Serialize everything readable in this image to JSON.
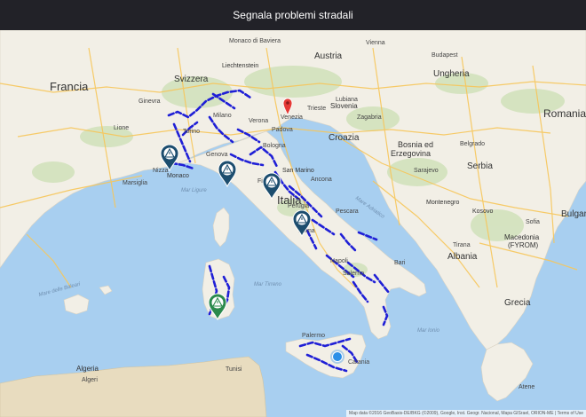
{
  "header": {
    "title": "Segnala problemi stradali"
  },
  "map": {
    "countries": [
      {
        "name": "Francia",
        "id": "francia"
      },
      {
        "name": "Svizzera",
        "id": "svizzera"
      },
      {
        "name": "Austria",
        "id": "austria"
      },
      {
        "name": "Ungheria",
        "id": "ungheria"
      },
      {
        "name": "Romania",
        "id": "romania"
      },
      {
        "name": "Slovenia",
        "id": "slovenia"
      },
      {
        "name": "Croazia",
        "id": "croazia"
      },
      {
        "name": "Bosnia ed",
        "id": "bosnia1"
      },
      {
        "name": "Erzegovina",
        "id": "bosnia2"
      },
      {
        "name": "Serbia",
        "id": "serbia"
      },
      {
        "name": "Italia",
        "id": "italia"
      },
      {
        "name": "Montenegro",
        "id": "montenegro"
      },
      {
        "name": "Kosovo",
        "id": "kosovo"
      },
      {
        "name": "Bulgaria",
        "id": "bulgaria"
      },
      {
        "name": "Macedonia",
        "id": "macedonia1"
      },
      {
        "name": "(FYROM)",
        "id": "macedonia2"
      },
      {
        "name": "Albania",
        "id": "albania"
      },
      {
        "name": "Grecia",
        "id": "grecia"
      },
      {
        "name": "Liechtenstein",
        "id": "liechtenstein"
      },
      {
        "name": "San Marino",
        "id": "sanmarino"
      },
      {
        "name": "Monaco",
        "id": "monaco"
      },
      {
        "name": "Algeria",
        "id": "algeria"
      }
    ],
    "cities": [
      {
        "name": "Torino",
        "id": "torino"
      },
      {
        "name": "Milano",
        "id": "milano"
      },
      {
        "name": "Genova",
        "id": "genova"
      },
      {
        "name": "Venezia",
        "id": "venezia"
      },
      {
        "name": "Padova",
        "id": "padova"
      },
      {
        "name": "Bologna",
        "id": "bologna"
      },
      {
        "name": "Firenze",
        "id": "firenze"
      },
      {
        "name": "Roma",
        "id": "roma"
      },
      {
        "name": "Napoli",
        "id": "napoli"
      },
      {
        "name": "Palermo",
        "id": "palermo"
      },
      {
        "name": "Marsiglia",
        "id": "marsiglia"
      },
      {
        "name": "Nizza",
        "id": "nizza"
      },
      {
        "name": "Lione",
        "id": "lione"
      },
      {
        "name": "Ginevra",
        "id": "ginevra"
      },
      {
        "name": "Zagabria",
        "id": "zagabria"
      },
      {
        "name": "Belgrado",
        "id": "belgrado"
      },
      {
        "name": "Sarajevo",
        "id": "sarajevo"
      },
      {
        "name": "Budapest",
        "id": "budapest"
      },
      {
        "name": "Vienna",
        "id": "vienna"
      },
      {
        "name": "Sofia",
        "id": "sofia"
      },
      {
        "name": "Tirana",
        "id": "tirana"
      },
      {
        "name": "Atene",
        "id": "atene"
      },
      {
        "name": "Tunisi",
        "id": "tunisi"
      },
      {
        "name": "Algeri",
        "id": "algeri"
      },
      {
        "name": "Bari",
        "id": "bari"
      },
      {
        "name": "Catania",
        "id": "catania"
      },
      {
        "name": "Salerno",
        "id": "salerno"
      },
      {
        "name": "Perugia",
        "id": "perugia"
      },
      {
        "name": "Ancona",
        "id": "ancona"
      },
      {
        "name": "Pescara",
        "id": "pescara"
      },
      {
        "name": "Verona",
        "id": "verona"
      },
      {
        "name": "Trieste",
        "id": "trieste"
      },
      {
        "name": "Lubiana",
        "id": "lubiana"
      },
      {
        "name": "Monaco di Baviera",
        "id": "munchen"
      }
    ],
    "seas": [
      {
        "name": "Mar Tirreno",
        "id": "tirreno"
      },
      {
        "name": "Mare Adriatico",
        "id": "adriatico"
      },
      {
        "name": "Mar Ligure",
        "id": "ligure"
      },
      {
        "name": "Mar Ionio",
        "id": "ionio"
      },
      {
        "name": "Mare delle Baleari",
        "id": "baleari"
      }
    ],
    "colors": {
      "water": "#a8cff0",
      "land": "#f2efe6",
      "africa": "#e8dcbf",
      "forest": "#c9deb0",
      "roads": "#f7c65a",
      "issue_routes": "#1f1fd6",
      "marker_navy": "#1c4d6e",
      "marker_green": "#2b8a4d",
      "marker_blue": "#2a8fe8",
      "pin_red": "#e53935"
    },
    "markers": [
      {
        "id": "torino",
        "type": "warning-pin",
        "color": "navy"
      },
      {
        "id": "genova",
        "type": "warning-pin",
        "color": "navy"
      },
      {
        "id": "firenze",
        "type": "warning-pin",
        "color": "navy"
      },
      {
        "id": "umbria",
        "type": "warning-pin",
        "color": "navy"
      },
      {
        "id": "sardegna",
        "type": "warning-pin",
        "color": "green"
      },
      {
        "id": "sicilia",
        "type": "cluster",
        "color": "blue"
      },
      {
        "id": "venezia",
        "type": "location-pin",
        "color": "red"
      }
    ],
    "attribution": "Map data ©2016 GeoBasis-DE/BKG (©2009), Google, Inst. Geogr. Nacional, Mapa GISrael, ORION-ME | Terms of Use"
  }
}
